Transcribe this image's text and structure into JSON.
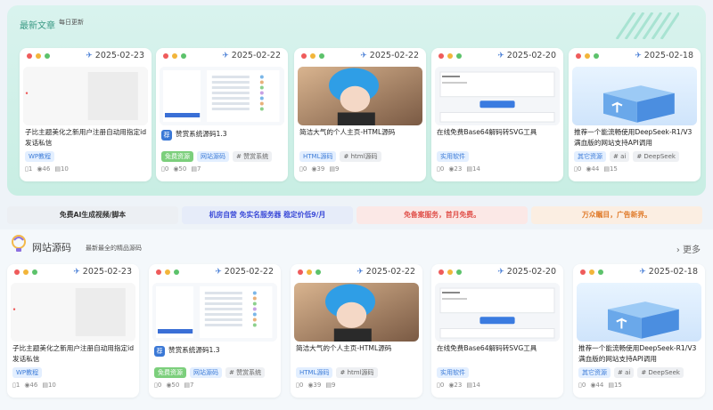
{
  "top_section": {
    "title": "最新文章",
    "subtitle": "每日更新"
  },
  "site_section": {
    "title": "网站源码",
    "subtitle": "最新最全的精品源码",
    "more": "更多"
  },
  "banners": [
    {
      "text": "免费AI生成视频/脚本",
      "color": "#333333",
      "bg": "#eceff3"
    },
    {
      "text": "机房自营 免实名服务器 稳定价低9/月",
      "color": "#3b4bd8",
      "bg": "#e6ecf9"
    },
    {
      "text": "免备案服务，首月免费。",
      "color": "#e0504a",
      "bg": "#fbe8e6"
    },
    {
      "text": "万众瞩目，广告新界。",
      "color": "#e07b2a",
      "bg": "#fbeee2"
    }
  ],
  "cards": [
    {
      "date": "2025-02-23",
      "title": "子比主题美化之新用户注册自动用指定id发话私信",
      "tags": [
        {
          "label": "WP教程",
          "style": "blue"
        }
      ],
      "views": "1",
      "likes": "46",
      "comments": "10",
      "thumb": "blank",
      "pin": ""
    },
    {
      "date": "2025-02-22",
      "title": "赞赏系统源码1.3",
      "tags": [
        {
          "label": "免费资源",
          "style": "green"
        },
        {
          "label": "网站源码",
          "style": "blue"
        },
        {
          "label": "# 赞赏系统",
          "style": "gray"
        }
      ],
      "views": "0",
      "likes": "50",
      "comments": "7",
      "thumb": "ui",
      "pin": "荐"
    },
    {
      "date": "2025-02-22",
      "title": "简洁大气的个人主页-HTML源码",
      "tags": [
        {
          "label": "HTML源码",
          "style": "blue"
        },
        {
          "label": "# html源码",
          "style": "gray"
        }
      ],
      "views": "0",
      "likes": "39",
      "comments": "9",
      "thumb": "photo",
      "pin": ""
    },
    {
      "date": "2025-02-20",
      "title": "在线免费Base64解码转SVG工具",
      "tags": [
        {
          "label": "实用软件",
          "style": "blue"
        }
      ],
      "views": "0",
      "likes": "23",
      "comments": "14",
      "thumb": "tool",
      "pin": ""
    },
    {
      "date": "2025-02-18",
      "title": "推荐一个能流畅使用DeepSeek-R1/V3满血版的网站支持API调用",
      "tags": [
        {
          "label": "其它资源",
          "style": "blue"
        },
        {
          "label": "# ai",
          "style": "gray"
        },
        {
          "label": "# DeepSeek",
          "style": "gray"
        }
      ],
      "views": "0",
      "likes": "44",
      "comments": "15",
      "thumb": "cube",
      "pin": ""
    }
  ],
  "colors": {
    "dot_red": "#ef5b5b",
    "dot_yellow": "#f2b53a",
    "dot_green": "#5cc26b",
    "accent": "#3a78d6"
  }
}
